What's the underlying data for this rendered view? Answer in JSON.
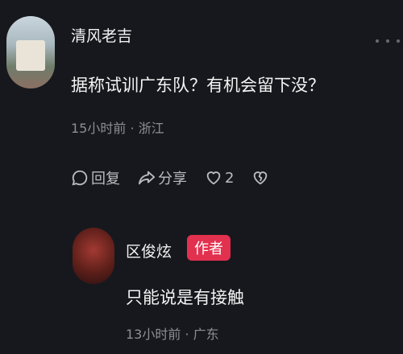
{
  "comment": {
    "username": "清风老吉",
    "text": "据称试训广东队？有机会留下没？",
    "time": "15小时前",
    "location": "浙江",
    "reply_label": "回复",
    "share_label": "分享",
    "like_count": "2"
  },
  "reply": {
    "username": "区俊炫",
    "badge": "作者",
    "text": "只能说是有接触",
    "time": "13小时前",
    "location": "广东"
  },
  "colors": {
    "background": "#17181d",
    "badge": "#e2304f",
    "meta_text": "#8d8e93"
  }
}
